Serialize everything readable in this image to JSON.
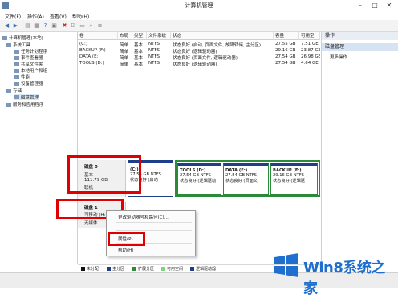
{
  "window": {
    "title": "计算机管理"
  },
  "menu": [
    "文件(F)",
    "操作(A)",
    "查看(V)",
    "帮助(H)"
  ],
  "tree": {
    "root": "计算机管理(本地)",
    "items": [
      "系统工具",
      "任务计划程序",
      "事件查看器",
      "共享文件夹",
      "本地用户和组",
      "性能",
      "设备管理器",
      "存储",
      "磁盘管理",
      "服务和应用程序"
    ]
  },
  "volume_table": {
    "headers": [
      "卷",
      "布局",
      "类型",
      "文件系统",
      "状态",
      "容量",
      "可用空"
    ],
    "rows": [
      [
        "(C:)",
        "简单",
        "基本",
        "NTFS",
        "状态良好 (启动, 页面文件, 故障转储, 主分区)",
        "27.55 GB",
        "7.51 GE"
      ],
      [
        "BACKUP (F:)",
        "简单",
        "基本",
        "NTFS",
        "状态良好 (逻辑驱动器)",
        "29.16 GB",
        "23.87 GE"
      ],
      [
        "DATA (E:)",
        "简单",
        "基本",
        "NTFS",
        "状态良好 (页面文件, 逻辑驱动器)",
        "27.54 GB",
        "26.98 GE"
      ],
      [
        "TOOLS (D:)",
        "简单",
        "基本",
        "NTFS",
        "状态良好 (逻辑驱动器)",
        "27.54 GB",
        "4.64 GE"
      ]
    ]
  },
  "actions": {
    "header": "操作",
    "section": "磁盘管理",
    "more": "更多操作"
  },
  "disk0": {
    "name": "磁盘 0",
    "type": "基本",
    "size": "111.79 GB",
    "status": "联机",
    "partitions": [
      {
        "name": "(C:)",
        "size": "27.55 GB NTFS",
        "status": "状态良好 (启动"
      },
      {
        "name": "TOOLS  (D:)",
        "size": "27.54 GB NTFS",
        "status": "状态良好 (逻辑驱动"
      },
      {
        "name": "DATA  (E:)",
        "size": "27.54 GB NTFS",
        "status": "状态良好 (页面文"
      },
      {
        "name": "BACKUP  (F:)",
        "size": "29.16 GB NTFS",
        "status": "状态良好 (逻辑驱"
      }
    ]
  },
  "disk1": {
    "name": "磁盘 1",
    "type": "可移动 (H:)",
    "status": "无媒体"
  },
  "context_menu": {
    "items": [
      "更改驱动器号和路径(C)...",
      "属性(P)",
      "帮助(H)"
    ]
  },
  "legend": [
    "未分配",
    "主分区",
    "扩展分区",
    "可用空间",
    "逻辑驱动器"
  ],
  "colors": {
    "unallocated": "#111111",
    "primary": "#1d3f8a",
    "extended": "#2a8a3a",
    "free": "#7bd67b",
    "logical": "#1d3f8a",
    "highlight_red": "#e00000"
  },
  "watermark": {
    "text": "Win8系统之家"
  }
}
